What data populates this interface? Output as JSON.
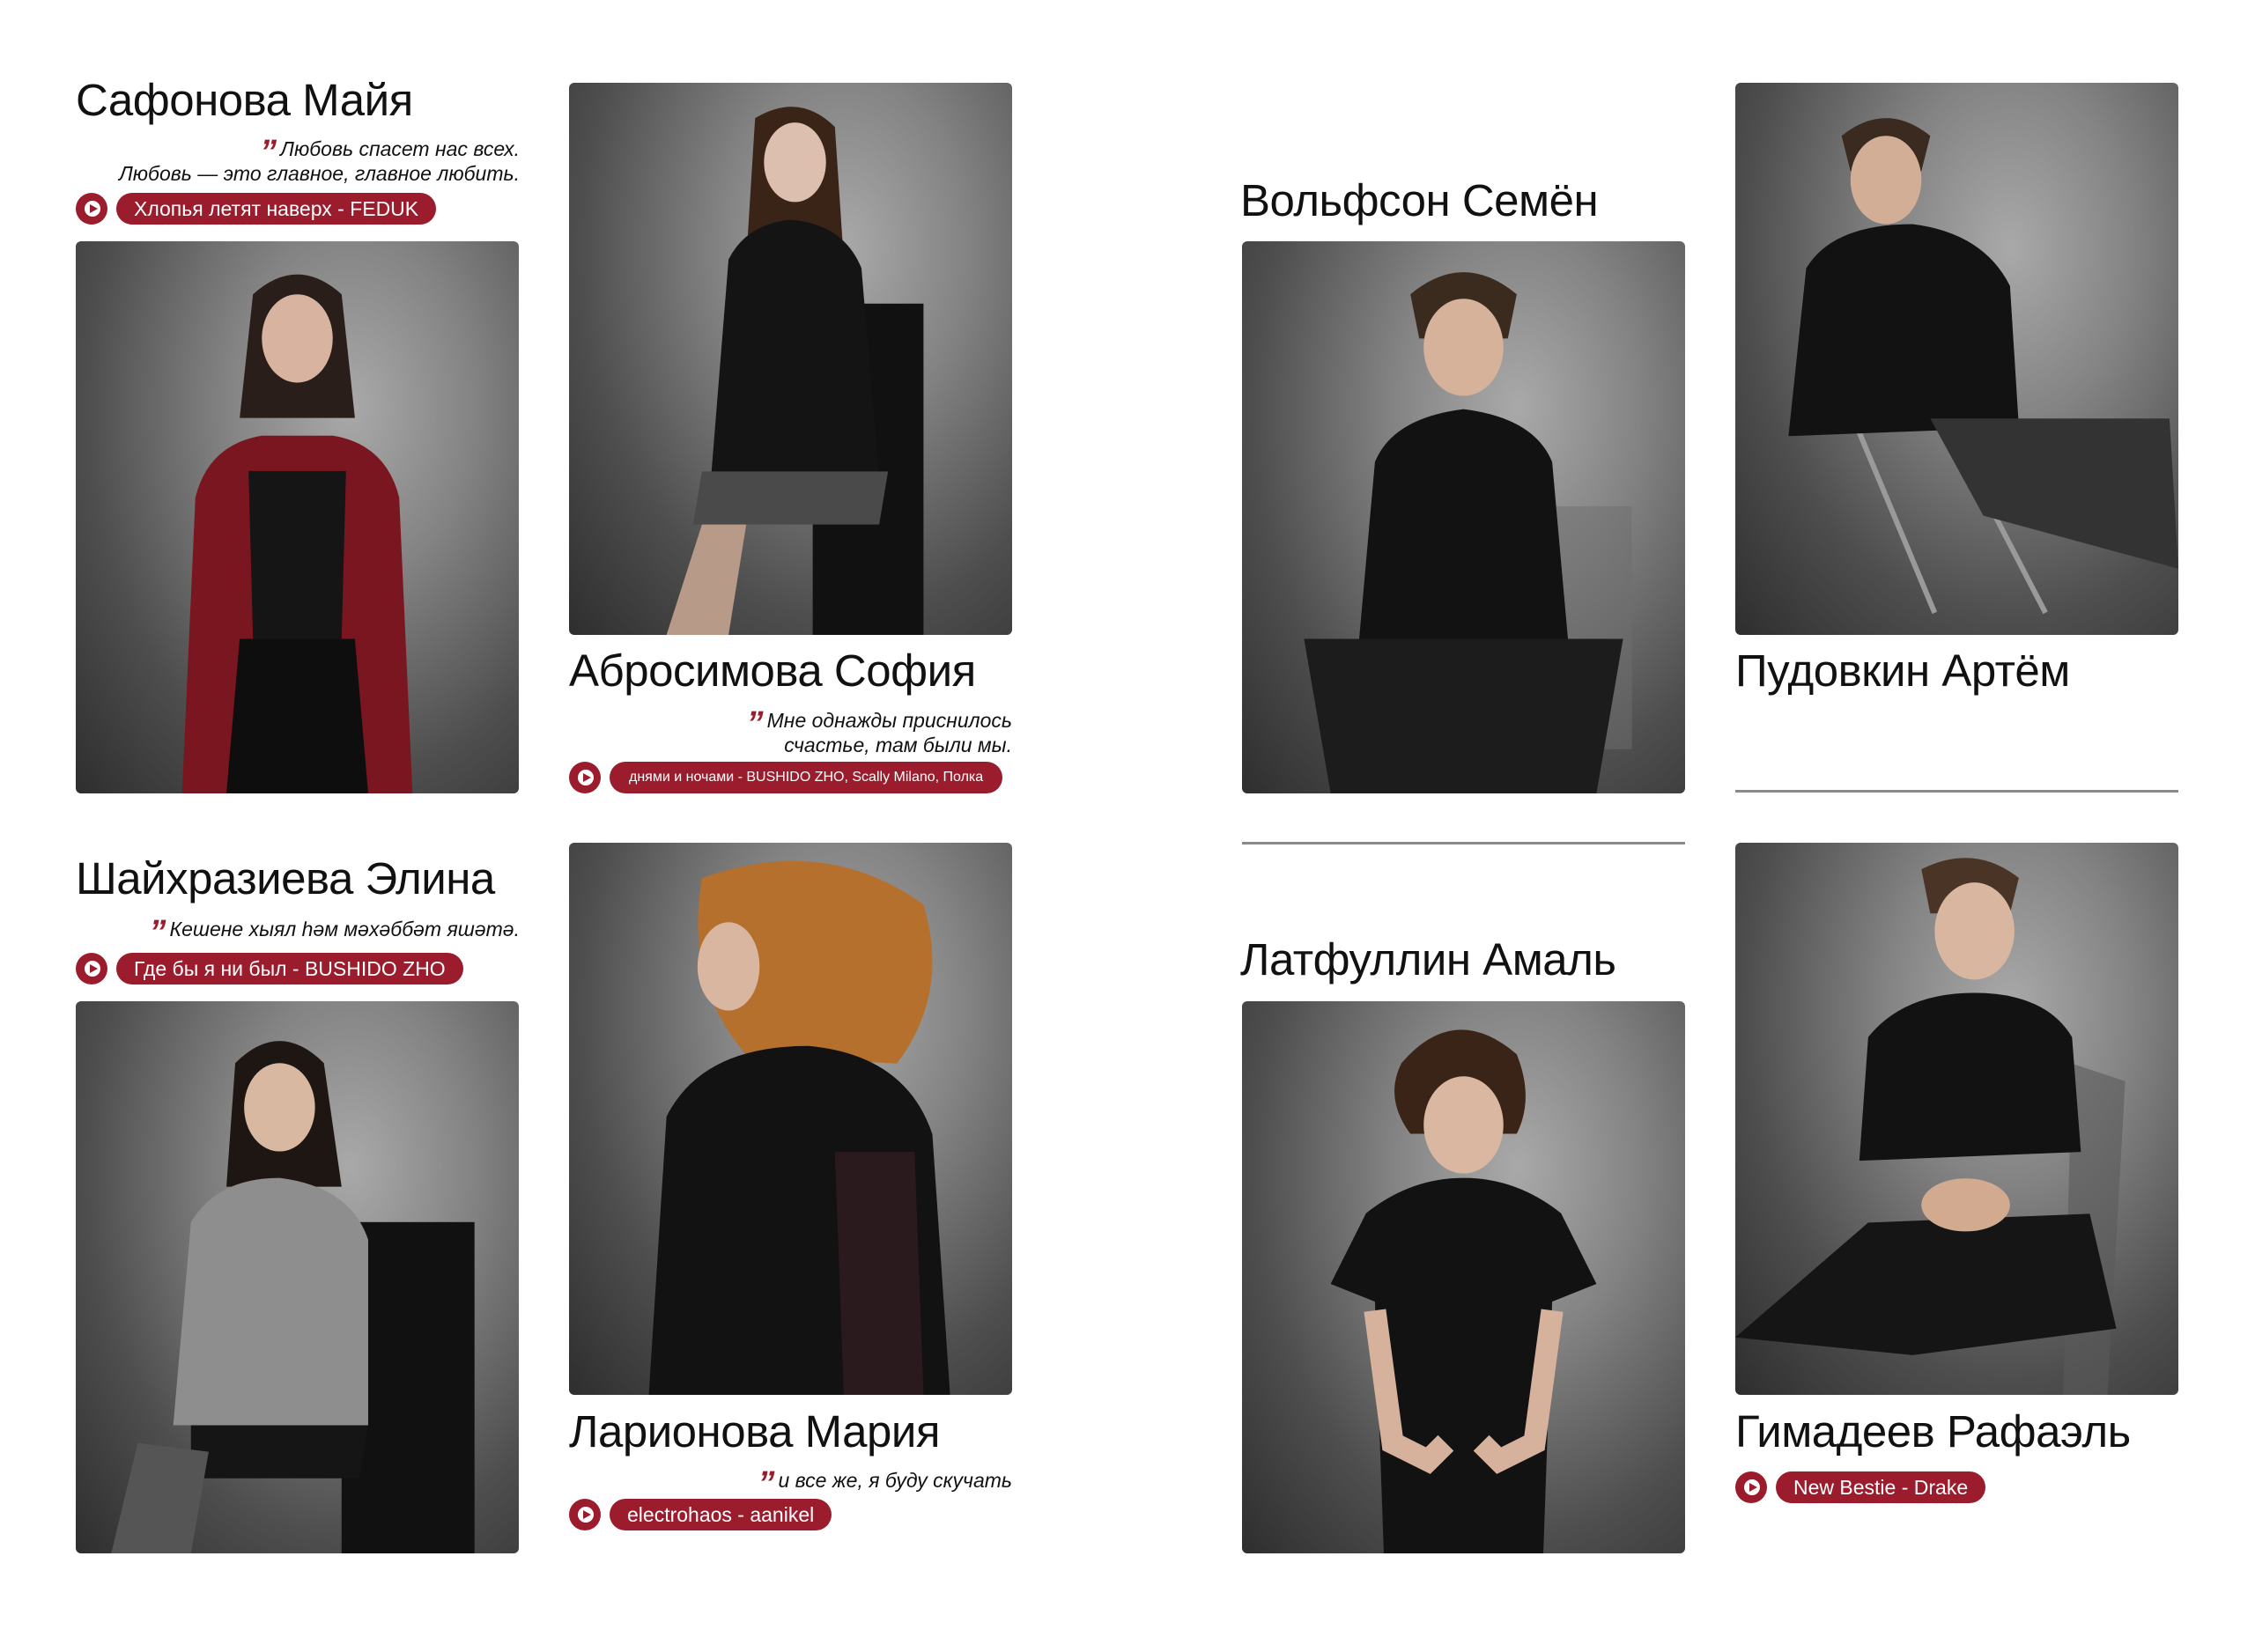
{
  "people": {
    "safonova": {
      "name": "Сафонова Майя",
      "quote_lines": [
        "Любовь спасет нас всех.",
        "Любовь — это главное, главное любить."
      ],
      "song": "Хлопья летят наверх - FEDUK"
    },
    "abrosimova": {
      "name": "Абросимова София",
      "quote_lines": [
        "Мне однажды приснилось",
        "счастье, там были мы."
      ],
      "song": "днями и ночами - BUSHIDO ZHO, Scally Milano, Полка"
    },
    "volfson": {
      "name": "Вольфсон Семён"
    },
    "pudovkin": {
      "name": "Пудовкин Артём"
    },
    "shaykhrazieva": {
      "name": "Шайхразиева Элина",
      "quote_lines": [
        "Кешене хыял һәм мәхәббәт яшәтә."
      ],
      "song": "Где бы я ни был - BUSHIDO ZHO"
    },
    "larionova": {
      "name": "Ларионова Мария",
      "quote_lines": [
        "и все же, я буду скучать"
      ],
      "song": "electrohaos - aanikel"
    },
    "latfullin": {
      "name": "Латфуллин Амаль"
    },
    "gimadeev": {
      "name": "Гимадеев Рафаэль",
      "song": "New Bestie - Drake"
    }
  },
  "quote_mark": "”",
  "colors": {
    "accent": "#9b1c2c",
    "background": "#ffffff",
    "text": "#111111",
    "divider": "#8a8a8a"
  },
  "icons": {
    "play": "play-icon"
  }
}
